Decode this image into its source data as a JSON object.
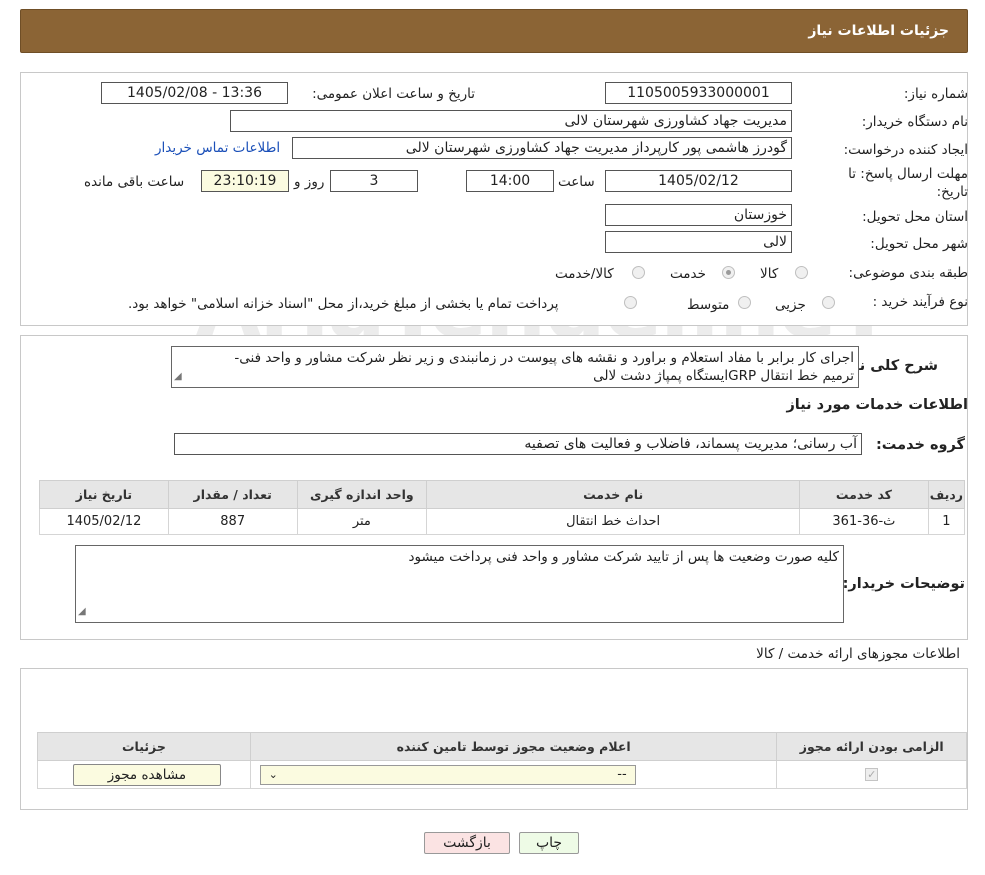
{
  "header": {
    "title": "جزئیات اطلاعات نیاز"
  },
  "form": {
    "need_number_label": "شماره نیاز:",
    "need_number": "1105005933000001",
    "announce_label": "تاریخ و ساعت اعلان عمومی:",
    "announce_value": "1405/02/08 - 13:36",
    "buyer_org_label": "نام دستگاه خریدار:",
    "buyer_org": "مدیریت جهاد کشاورزی شهرستان لالی",
    "requester_label": "ایجاد کننده درخواست:",
    "requester": "گودرز هاشمی پور کارپرداز مدیریت جهاد کشاورزی شهرستان لالی",
    "contact_link": "اطلاعات تماس خریدار",
    "deadline_label_1": "مهلت ارسال پاسخ: تا",
    "deadline_label_2": "تاریخ:",
    "deadline_date": "1405/02/12",
    "time_label": "ساعت",
    "deadline_time": "14:00",
    "days": "3",
    "days_label": "روز و",
    "remaining": "23:10:19",
    "remaining_label": "ساعت باقی مانده",
    "province_label": "استان محل تحویل:",
    "province": "خوزستان",
    "city_label": "شهر محل تحویل:",
    "city": "لالی",
    "category_label": "طبقه بندی موضوعی:",
    "category_options": [
      "کالا",
      "خدمت",
      "کالا/خدمت"
    ],
    "purchase_type_label": "نوع فرآیند خرید :",
    "purchase_options": [
      "جزیی",
      "متوسط"
    ],
    "purchase_note": "پرداخت تمام یا بخشی از مبلغ خرید،از محل \"اسناد خزانه اسلامی\" خواهد بود."
  },
  "description": {
    "label": "شرح کلی نیاز:",
    "line1": "اجرای کار برابر با مفاد استعلام و براورد و نقشه های پیوست  در زمانبندی و زیر نظر شرکت مشاور و واحد فنی-",
    "line2": "ترمیم خط انتقال GRPایستگاه پمپاژ دشت لالی"
  },
  "services": {
    "section_title": "اطلاعات خدمات مورد نیاز",
    "group_label": "گروه خدمت:",
    "group_value": "آب رسانی؛ مدیریت پسماند، فاضلاب و فعالیت های تصفیه",
    "columns": [
      "ردیف",
      "کد خدمت",
      "نام خدمت",
      "واحد اندازه گیری",
      "تعداد / مقدار",
      "تاریخ نیاز"
    ],
    "rows": [
      [
        "1",
        "ث-36-361",
        "احداث خط انتقال",
        "متر",
        "887",
        "1405/02/12"
      ]
    ]
  },
  "buyer_notes": {
    "label": "توضیحات خریدار:",
    "text": "کلیه صورت وضعیت ها پس از تایید شرکت مشاور و واحد فنی پرداخت میشود"
  },
  "permits": {
    "section_title": "اطلاعات مجوزهای ارائه خدمت / کالا",
    "columns": [
      "الزامی بودن ارائه مجوز",
      "اعلام وضعیت مجوز توسط تامین کننده",
      "جزئیات"
    ],
    "select_value": "--",
    "view_button": "مشاهده مجوز"
  },
  "footer": {
    "print": "چاپ",
    "back": "بازگشت"
  },
  "watermark": "AriaTender.neT",
  "colors": {
    "header_bg": "#8b6435",
    "link": "#1a4fb8",
    "back_bg": "#fbe3e3",
    "print_bg": "#eefbe6"
  }
}
